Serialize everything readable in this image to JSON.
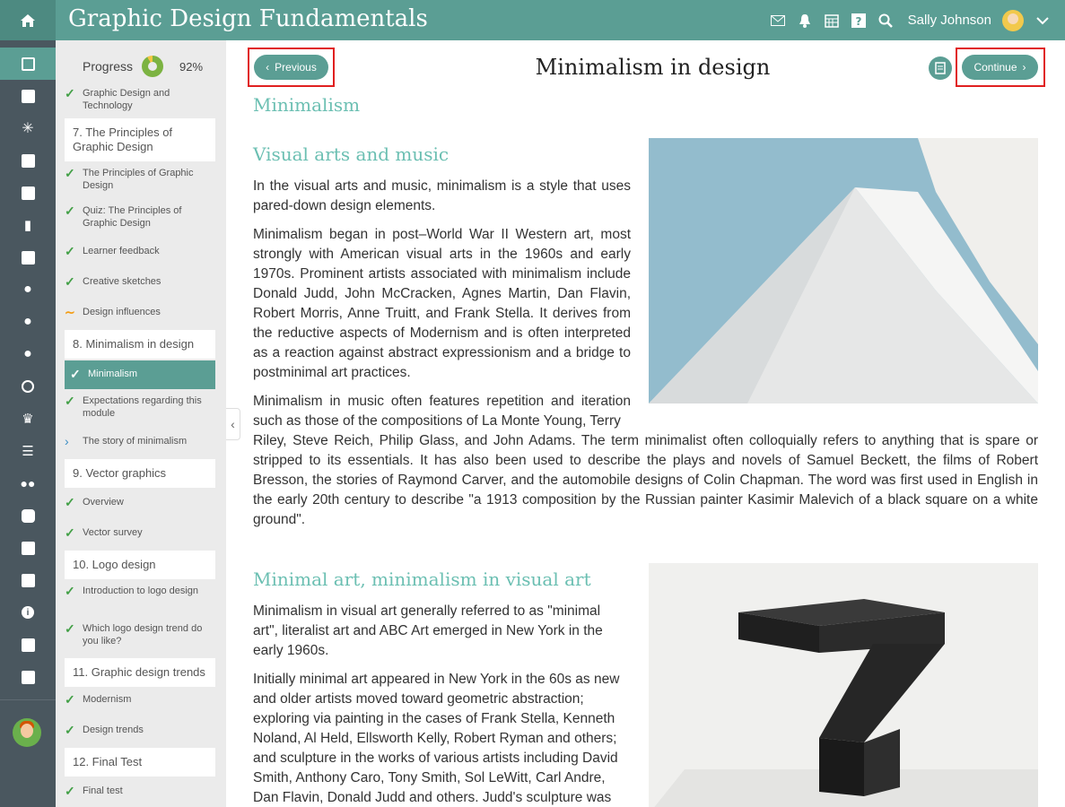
{
  "app": {
    "title": "Graphic Design Fundamentals"
  },
  "user": {
    "name": "Sally Johnson"
  },
  "progress": {
    "label": "Progress",
    "value": "92%",
    "fraction": 0.92
  },
  "toc": {
    "items": [
      {
        "text": "Graphic Design and Technology",
        "type": "check"
      },
      {
        "text": "7. The Principles of Graphic Design",
        "type": "section"
      },
      {
        "text": "The Principles of Graphic Design",
        "type": "check"
      },
      {
        "text": "Quiz: The Principles of Graphic Design",
        "type": "check"
      },
      {
        "text": "Learner feedback",
        "type": "check"
      },
      {
        "text": "Creative sketches",
        "type": "check"
      },
      {
        "text": "Design influences",
        "type": "tilde"
      },
      {
        "text": "8. Minimalism in design",
        "type": "section"
      },
      {
        "text": "Minimalism",
        "type": "active"
      },
      {
        "text": "Expectations regarding this module",
        "type": "check"
      },
      {
        "text": "The story of minimalism",
        "type": "chev"
      },
      {
        "text": "9. Vector graphics",
        "type": "section"
      },
      {
        "text": "Overview",
        "type": "check"
      },
      {
        "text": "Vector survey",
        "type": "check"
      },
      {
        "text": "10. Logo design",
        "type": "section"
      },
      {
        "text": "Introduction to logo design",
        "type": "check"
      },
      {
        "text": "Which logo design trend do you like?",
        "type": "check"
      },
      {
        "text": "11. Graphic design trends",
        "type": "section"
      },
      {
        "text": "Modernism",
        "type": "check"
      },
      {
        "text": "Design trends",
        "type": "check"
      },
      {
        "text": "12. Final Test",
        "type": "section"
      },
      {
        "text": "Final test",
        "type": "check"
      }
    ]
  },
  "nav": {
    "previous": "Previous",
    "continue": "Continue"
  },
  "page": {
    "title": "Minimalism in design",
    "heading": "Minimalism",
    "section1": {
      "heading": "Visual arts and music",
      "p1": "In the visual arts and music, minimalism is a style that uses pared-down design elements.",
      "p2": "Minimalism began in post–World War II Western art, most strongly with American visual arts in the 1960s and early 1970s. Prominent artists associated with minimalism include Donald Judd, John McCracken, Agnes Martin, Dan Flavin, Robert Morris, Anne Truitt, and Frank Stella. It derives from the reductive aspects of Modernism and is often interpreted as a reaction against abstract expressionism and a bridge to postminimal art practices.",
      "p3a": "Minimalism in music often features repetition and iteration such as those of the compositions of La Monte Young, Terry",
      "p3b": "Riley, Steve Reich, Philip Glass, and John Adams. The term minimalist often colloquially refers to anything that is spare or stripped to its essentials. It has also been used to describe the plays and novels of Samuel Beckett, the films of Robert Bresson, the stories of Raymond Carver, and the automobile designs of Colin Chapman. The word was first used in English in the early 20th century to describe \"a 1913 composition by the Russian painter Kasimir Malevich of a black square on a white ground\"."
    },
    "section2": {
      "heading": "Minimal art, minimalism in visual art",
      "p1": "Minimalism in visual art generally referred to as \"minimal art\", literalist art and ABC Art emerged in New York in the early 1960s.",
      "p2": "Initially minimal art appeared in New York in the 60s as new and older artists moved toward geometric abstraction; exploring via painting in the cases of Frank Stella, Kenneth Noland, Al Held, Ellsworth Kelly, Robert Ryman and others; and sculpture in the works of various artists including David Smith, Anthony Caro, Tony Smith, Sol LeWitt, Carl Andre, Dan Flavin, Donald Judd and others. Judd's sculpture was"
    }
  },
  "sidebar_icons": [
    "course-icon",
    "catalog-icon",
    "spinner-icon",
    "check-icon",
    "calendar-grid-icon",
    "chart-icon",
    "library-icon",
    "user-icon",
    "user-tie-icon",
    "user-group-icon",
    "clock-icon",
    "trophy-icon",
    "list-icon",
    "groups-icon",
    "chat-icon",
    "edit-icon",
    "calendar-icon",
    "info-icon",
    "folder-icon",
    "book-icon"
  ],
  "colors": {
    "accent": "#5b9e94",
    "heading": "#6bbfb2",
    "sidebar": "#4a575f",
    "highlight": "#e02020"
  }
}
